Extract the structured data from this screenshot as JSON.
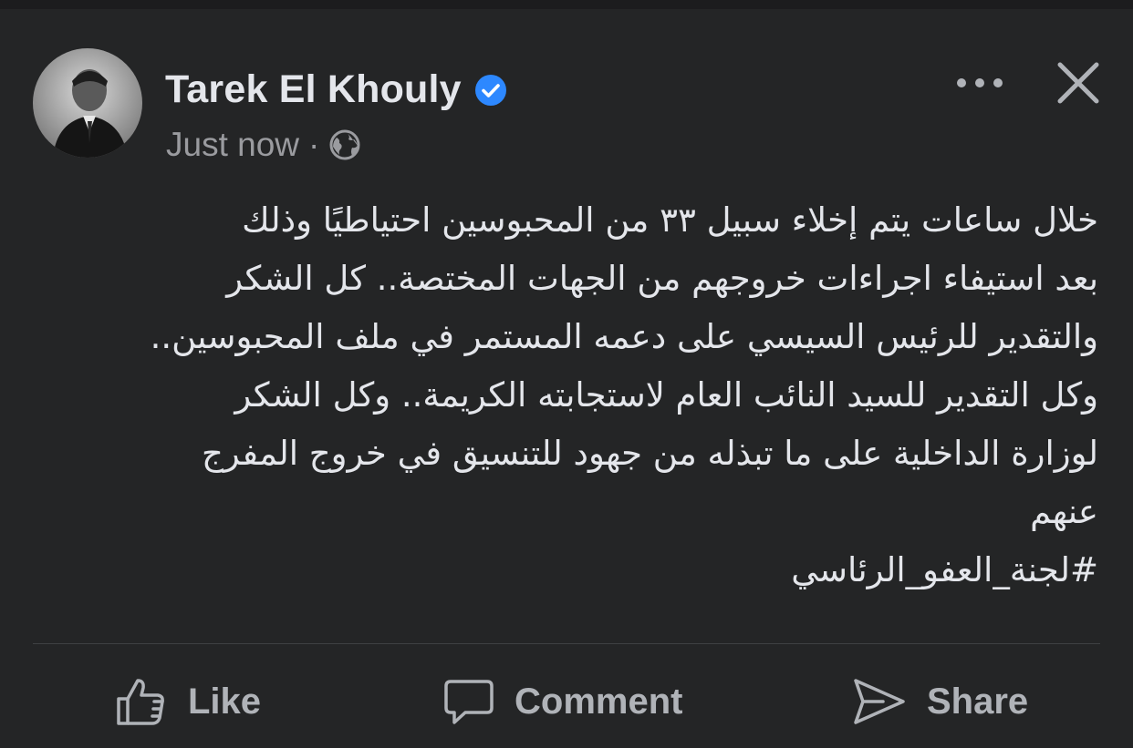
{
  "post": {
    "author": {
      "name": "Tarek El Khouly",
      "verified": true
    },
    "timestamp": "Just now",
    "separator": "·",
    "audience_icon": "globe-icon",
    "header_actions": [
      "more-options-icon",
      "close-icon"
    ],
    "body_lines": [
      "خلال ساعات يتم إخلاء سبيل ٣٣ من المحبوسين احتياطيًا وذلك",
      "بعد استيفاء اجراءات خروجهم من الجهات المختصة.. كل الشكر",
      "والتقدير للرئيس السيسي على دعمه المستمر في ملف المحبوسين..",
      "وكل التقدير للسيد النائب العام لاستجابته الكريمة.. وكل الشكر",
      "لوزارة الداخلية على ما تبذله من جهود للتنسيق في خروج المفرج",
      "عنهم"
    ],
    "hashtag": "#لجنة_العفو_الرئاسي"
  },
  "actions": {
    "like": {
      "label": "Like",
      "icon": "thumbs-up-icon"
    },
    "comment": {
      "label": "Comment",
      "icon": "comment-icon"
    },
    "share": {
      "label": "Share",
      "icon": "share-icon"
    }
  },
  "colors": {
    "background": "#242526",
    "text_primary": "#e4e6eb",
    "text_secondary": "#9a9b9f",
    "verified_badge": "#2d88ff",
    "divider": "#3e4042"
  }
}
